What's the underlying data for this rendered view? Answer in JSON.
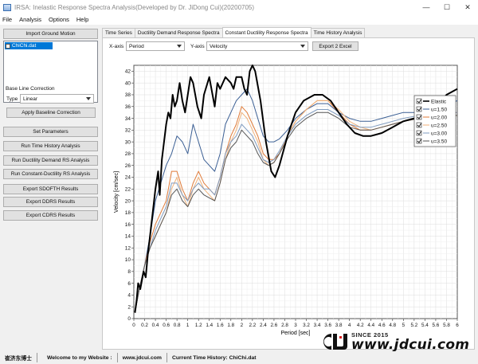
{
  "window": {
    "title": "IRSA: Inelastic Response Spectra Analysis(Developed by Dr. JiDong Cui)(20200705)"
  },
  "menu": [
    "File",
    "Analysis",
    "Options",
    "Help"
  ],
  "left": {
    "import_button": "Import Ground Motion",
    "file_item": "ChiChi.dat",
    "baseline_heading": "Base Line Correction",
    "type_label": "Type",
    "type_value": "Linear",
    "apply_baseline_button": "Apply Baseline Correction",
    "buttons": [
      "Set Parameters",
      "Run Time History Analysis",
      "Run Ductility Demand RS Analysis",
      "Run Constant-Ductility RS Analysis",
      "Export SDOFTH Results",
      "Export DDRS Results",
      "Export CDRS Results"
    ]
  },
  "tabs": [
    "Time Series",
    "Ductility Demand Response Spectra",
    "Constant Ductility Response Spectra",
    "Time History Analysis"
  ],
  "controls": {
    "xaxis_label": "X-axis",
    "xaxis_value": "Period",
    "yaxis_label": "Y-axis",
    "yaxis_value": "Velocity",
    "export_button": "Export 2 Excel"
  },
  "status": {
    "author": "崔济东博士",
    "welcome": "Welcome to my Website :",
    "website": "www.jdcui.com",
    "current": "Current Time History: ChiChi.dat"
  },
  "watermark": {
    "since": "SINCE 2015",
    "url": "www.jdcui.com"
  },
  "chart_data": {
    "type": "line",
    "xlabel": "Period [sec]",
    "ylabel": "Velocity [cm/sec]",
    "xlim": [
      0,
      6
    ],
    "ylim": [
      0,
      43
    ],
    "xticks": [
      "0",
      "0.2",
      "0.4",
      "0.6",
      "0.8",
      "1",
      "1.2",
      "1.4",
      "1.6",
      "1.8",
      "2",
      "2.2",
      "2.4",
      "2.6",
      "2.8",
      "3",
      "3.2",
      "3.4",
      "3.6",
      "3.8",
      "4",
      "4.2",
      "4.4",
      "4.6",
      "4.8",
      "5",
      "5.2",
      "5.4",
      "5.6",
      "5.8",
      "6"
    ],
    "yticks": [
      0,
      2,
      4,
      6,
      8,
      10,
      12,
      14,
      16,
      18,
      20,
      22,
      24,
      26,
      28,
      30,
      32,
      34,
      36,
      38,
      40,
      42
    ],
    "grid": true,
    "legend_position": "right",
    "series": [
      {
        "name": "Elastic",
        "color": "#000000",
        "width": 2,
        "points": [
          [
            0.02,
            1
          ],
          [
            0.05,
            3
          ],
          [
            0.08,
            6
          ],
          [
            0.12,
            5
          ],
          [
            0.18,
            8
          ],
          [
            0.22,
            7
          ],
          [
            0.26,
            11
          ],
          [
            0.3,
            14
          ],
          [
            0.35,
            18
          ],
          [
            0.4,
            22
          ],
          [
            0.45,
            25
          ],
          [
            0.48,
            21
          ],
          [
            0.52,
            27
          ],
          [
            0.56,
            30
          ],
          [
            0.6,
            33
          ],
          [
            0.64,
            35
          ],
          [
            0.68,
            34
          ],
          [
            0.72,
            38
          ],
          [
            0.76,
            36
          ],
          [
            0.8,
            37
          ],
          [
            0.85,
            40
          ],
          [
            0.9,
            37
          ],
          [
            0.95,
            35
          ],
          [
            1.0,
            38
          ],
          [
            1.05,
            41
          ],
          [
            1.1,
            40
          ],
          [
            1.18,
            36
          ],
          [
            1.25,
            34
          ],
          [
            1.3,
            38
          ],
          [
            1.4,
            41
          ],
          [
            1.5,
            36
          ],
          [
            1.55,
            40
          ],
          [
            1.6,
            39
          ],
          [
            1.7,
            41
          ],
          [
            1.8,
            40
          ],
          [
            1.85,
            39
          ],
          [
            1.9,
            41
          ],
          [
            2.0,
            41
          ],
          [
            2.05,
            39
          ],
          [
            2.1,
            38
          ],
          [
            2.15,
            42
          ],
          [
            2.2,
            43
          ],
          [
            2.25,
            42
          ],
          [
            2.35,
            37
          ],
          [
            2.45,
            30
          ],
          [
            2.55,
            25
          ],
          [
            2.62,
            24
          ],
          [
            2.7,
            26
          ],
          [
            2.85,
            31
          ],
          [
            3.0,
            35
          ],
          [
            3.15,
            37
          ],
          [
            3.35,
            38
          ],
          [
            3.5,
            38
          ],
          [
            3.65,
            37
          ],
          [
            3.8,
            35
          ],
          [
            3.95,
            33
          ],
          [
            4.1,
            31.5
          ],
          [
            4.25,
            31
          ],
          [
            4.4,
            31
          ],
          [
            4.6,
            31.5
          ],
          [
            4.8,
            32.5
          ],
          [
            5.0,
            33.5
          ],
          [
            5.2,
            34
          ],
          [
            5.4,
            35
          ],
          [
            5.6,
            36
          ],
          [
            5.8,
            38
          ],
          [
            6.0,
            39
          ]
        ]
      },
      {
        "name": "u=1.50",
        "color": "#3b5f94",
        "width": 1,
        "points": [
          [
            0.02,
            1
          ],
          [
            0.1,
            5
          ],
          [
            0.2,
            9
          ],
          [
            0.3,
            14
          ],
          [
            0.4,
            20
          ],
          [
            0.5,
            23
          ],
          [
            0.6,
            26
          ],
          [
            0.7,
            28
          ],
          [
            0.8,
            31
          ],
          [
            0.9,
            30
          ],
          [
            1.0,
            28
          ],
          [
            1.1,
            33
          ],
          [
            1.2,
            30
          ],
          [
            1.3,
            27
          ],
          [
            1.4,
            26
          ],
          [
            1.5,
            25
          ],
          [
            1.6,
            28
          ],
          [
            1.7,
            33
          ],
          [
            1.8,
            35
          ],
          [
            1.9,
            37
          ],
          [
            2.0,
            38
          ],
          [
            2.1,
            39
          ],
          [
            2.2,
            37
          ],
          [
            2.3,
            34
          ],
          [
            2.4,
            31
          ],
          [
            2.5,
            30
          ],
          [
            2.6,
            30
          ],
          [
            2.7,
            30.5
          ],
          [
            2.85,
            32
          ],
          [
            3.0,
            34
          ],
          [
            3.2,
            35.5
          ],
          [
            3.4,
            36.5
          ],
          [
            3.6,
            36.5
          ],
          [
            3.8,
            35
          ],
          [
            4.0,
            34
          ],
          [
            4.2,
            33.5
          ],
          [
            4.4,
            33.5
          ],
          [
            4.6,
            34
          ],
          [
            4.8,
            34.5
          ],
          [
            5.0,
            35
          ],
          [
            5.3,
            35
          ],
          [
            5.6,
            35.5
          ],
          [
            6.0,
            37
          ]
        ]
      },
      {
        "name": "u=2.00",
        "color": "#e07b39",
        "width": 1,
        "points": [
          [
            0.02,
            1
          ],
          [
            0.1,
            5
          ],
          [
            0.2,
            9
          ],
          [
            0.3,
            13
          ],
          [
            0.4,
            16
          ],
          [
            0.5,
            18
          ],
          [
            0.6,
            20
          ],
          [
            0.7,
            25
          ],
          [
            0.8,
            25
          ],
          [
            0.9,
            22
          ],
          [
            1.0,
            20
          ],
          [
            1.1,
            23
          ],
          [
            1.2,
            25
          ],
          [
            1.3,
            23
          ],
          [
            1.4,
            22
          ],
          [
            1.5,
            21
          ],
          [
            1.6,
            24
          ],
          [
            1.7,
            28
          ],
          [
            1.8,
            31
          ],
          [
            1.9,
            33
          ],
          [
            2.0,
            36
          ],
          [
            2.1,
            35
          ],
          [
            2.2,
            33
          ],
          [
            2.3,
            31
          ],
          [
            2.4,
            28
          ],
          [
            2.5,
            27
          ],
          [
            2.6,
            27
          ],
          [
            2.7,
            28
          ],
          [
            2.85,
            31
          ],
          [
            3.0,
            33.5
          ],
          [
            3.2,
            35.5
          ],
          [
            3.4,
            37
          ],
          [
            3.6,
            37
          ],
          [
            3.8,
            35
          ],
          [
            4.0,
            33
          ],
          [
            4.2,
            32
          ],
          [
            4.4,
            32
          ],
          [
            4.6,
            32.5
          ],
          [
            4.8,
            33
          ],
          [
            5.0,
            33.5
          ],
          [
            5.3,
            34
          ],
          [
            5.6,
            34.5
          ],
          [
            6.0,
            35
          ]
        ]
      },
      {
        "name": "u=2.50",
        "color": "#f0b27a",
        "width": 1,
        "points": [
          [
            0.02,
            1
          ],
          [
            0.1,
            5
          ],
          [
            0.2,
            9
          ],
          [
            0.3,
            12
          ],
          [
            0.4,
            14
          ],
          [
            0.5,
            16
          ],
          [
            0.6,
            18
          ],
          [
            0.7,
            22
          ],
          [
            0.8,
            24
          ],
          [
            0.9,
            21
          ],
          [
            1.0,
            19
          ],
          [
            1.1,
            22
          ],
          [
            1.2,
            24
          ],
          [
            1.3,
            22
          ],
          [
            1.4,
            21
          ],
          [
            1.5,
            20
          ],
          [
            1.6,
            23
          ],
          [
            1.7,
            27
          ],
          [
            1.8,
            30
          ],
          [
            1.9,
            32
          ],
          [
            2.0,
            35
          ],
          [
            2.1,
            34
          ],
          [
            2.2,
            32
          ],
          [
            2.3,
            30
          ],
          [
            2.4,
            27
          ],
          [
            2.5,
            26
          ],
          [
            2.6,
            26.5
          ],
          [
            2.7,
            28
          ],
          [
            2.85,
            31
          ],
          [
            3.0,
            33.5
          ],
          [
            3.2,
            35.5
          ],
          [
            3.4,
            37
          ],
          [
            3.6,
            37
          ],
          [
            3.8,
            35.5
          ],
          [
            4.0,
            33.5
          ],
          [
            4.2,
            32.5
          ],
          [
            4.4,
            32
          ],
          [
            4.6,
            32.5
          ],
          [
            4.8,
            33
          ],
          [
            5.0,
            33.5
          ],
          [
            5.3,
            34
          ],
          [
            5.6,
            34
          ],
          [
            6.0,
            34.5
          ]
        ]
      },
      {
        "name": "u=3.00",
        "color": "#7f9bbf",
        "width": 1,
        "points": [
          [
            0.02,
            1
          ],
          [
            0.1,
            5
          ],
          [
            0.2,
            9
          ],
          [
            0.3,
            12
          ],
          [
            0.4,
            15
          ],
          [
            0.5,
            17
          ],
          [
            0.6,
            19
          ],
          [
            0.7,
            23
          ],
          [
            0.8,
            23
          ],
          [
            0.9,
            21
          ],
          [
            1.0,
            20
          ],
          [
            1.1,
            22
          ],
          [
            1.2,
            23
          ],
          [
            1.3,
            22
          ],
          [
            1.4,
            22
          ],
          [
            1.5,
            21
          ],
          [
            1.6,
            24
          ],
          [
            1.7,
            28
          ],
          [
            1.8,
            30
          ],
          [
            1.9,
            31
          ],
          [
            2.0,
            33
          ],
          [
            2.1,
            32
          ],
          [
            2.2,
            31
          ],
          [
            2.3,
            29
          ],
          [
            2.4,
            27
          ],
          [
            2.5,
            26.5
          ],
          [
            2.6,
            27
          ],
          [
            2.7,
            28.5
          ],
          [
            2.85,
            31
          ],
          [
            3.0,
            33
          ],
          [
            3.2,
            34.5
          ],
          [
            3.4,
            35.5
          ],
          [
            3.6,
            35.5
          ],
          [
            3.8,
            34.5
          ],
          [
            4.0,
            33
          ],
          [
            4.2,
            32.5
          ],
          [
            4.4,
            32.5
          ],
          [
            4.6,
            33
          ],
          [
            4.8,
            33.5
          ],
          [
            5.0,
            34
          ],
          [
            5.3,
            34.5
          ],
          [
            5.6,
            35
          ],
          [
            6.0,
            35
          ]
        ]
      },
      {
        "name": "u=3.50",
        "color": "#555555",
        "width": 1,
        "points": [
          [
            0.02,
            1
          ],
          [
            0.1,
            5
          ],
          [
            0.2,
            9
          ],
          [
            0.3,
            12
          ],
          [
            0.4,
            14
          ],
          [
            0.5,
            16
          ],
          [
            0.6,
            18
          ],
          [
            0.7,
            21
          ],
          [
            0.8,
            22
          ],
          [
            0.9,
            20
          ],
          [
            1.0,
            19
          ],
          [
            1.1,
            21
          ],
          [
            1.2,
            22
          ],
          [
            1.3,
            21
          ],
          [
            1.4,
            20.5
          ],
          [
            1.5,
            20
          ],
          [
            1.6,
            23
          ],
          [
            1.7,
            27
          ],
          [
            1.8,
            29
          ],
          [
            1.9,
            30
          ],
          [
            2.0,
            32
          ],
          [
            2.1,
            31
          ],
          [
            2.2,
            30
          ],
          [
            2.3,
            28
          ],
          [
            2.4,
            26.5
          ],
          [
            2.5,
            26
          ],
          [
            2.6,
            26.5
          ],
          [
            2.7,
            28
          ],
          [
            2.85,
            30.5
          ],
          [
            3.0,
            32.5
          ],
          [
            3.2,
            34
          ],
          [
            3.4,
            35
          ],
          [
            3.6,
            35
          ],
          [
            3.8,
            34
          ],
          [
            4.0,
            32.5
          ],
          [
            4.2,
            32
          ],
          [
            4.4,
            32
          ],
          [
            4.6,
            32.5
          ],
          [
            4.8,
            33
          ],
          [
            5.0,
            33.5
          ],
          [
            5.3,
            34
          ],
          [
            5.6,
            34.5
          ],
          [
            6.0,
            34.5
          ]
        ]
      }
    ]
  }
}
